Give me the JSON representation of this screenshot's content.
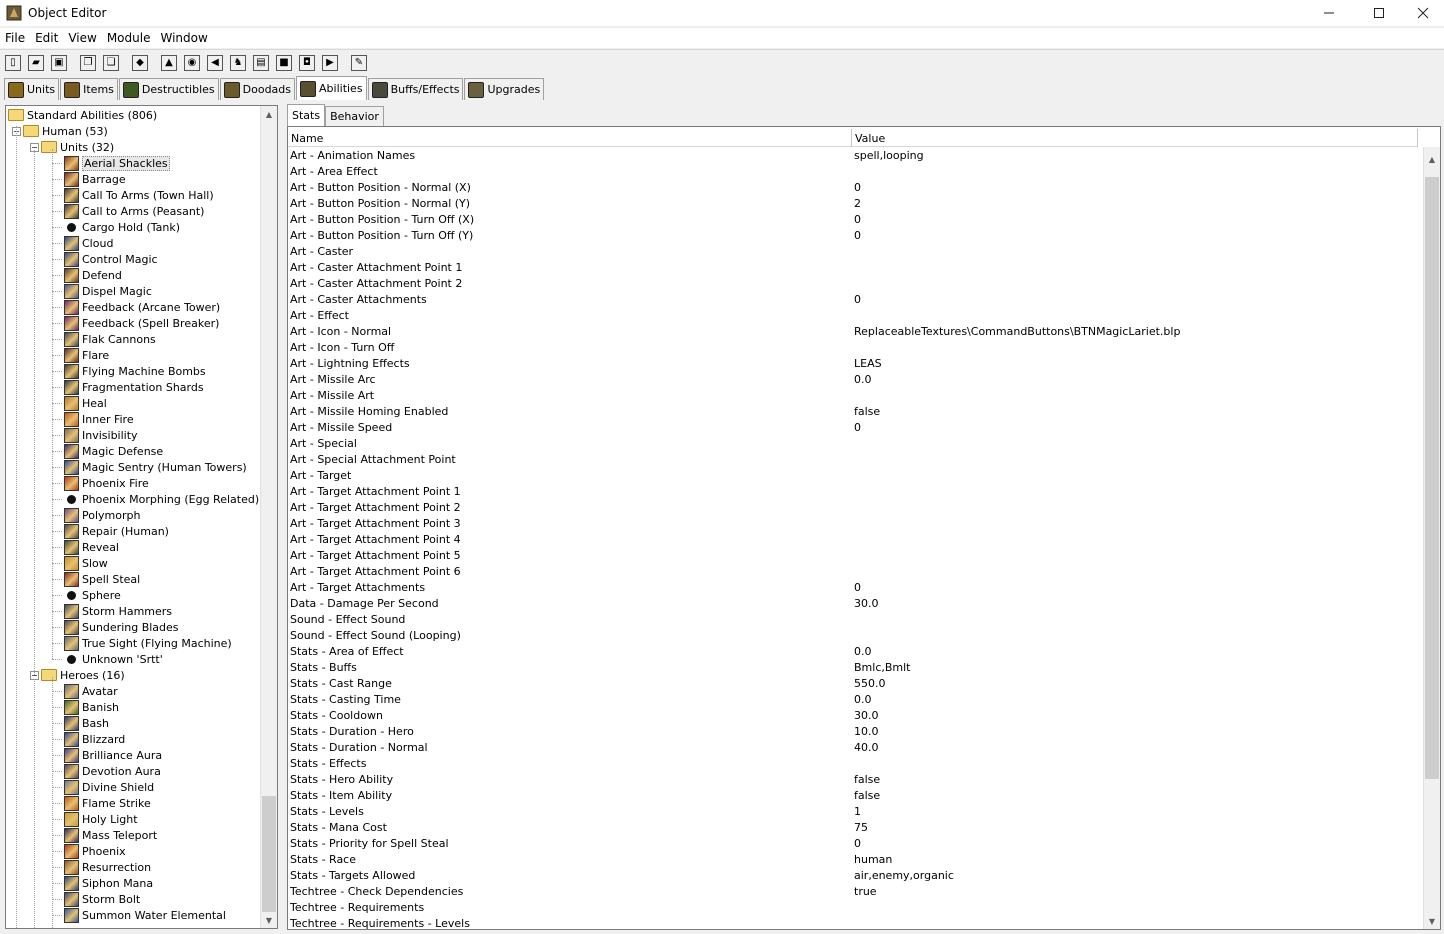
{
  "window": {
    "title": "Object Editor"
  },
  "menu": [
    "File",
    "Edit",
    "View",
    "Module",
    "Window"
  ],
  "toolbar": [
    {
      "icon": "new-icon",
      "glyph": "▯"
    },
    {
      "icon": "open-icon",
      "glyph": "▰"
    },
    {
      "icon": "save-icon",
      "glyph": "▣"
    },
    {
      "sep": true
    },
    {
      "icon": "copy-icon",
      "glyph": "❐"
    },
    {
      "icon": "paste-icon",
      "glyph": "❏"
    },
    {
      "sep": true
    },
    {
      "icon": "terrain-editor-icon",
      "glyph": "◆"
    },
    {
      "sep": true
    },
    {
      "icon": "trigger-editor-icon",
      "glyph": "▲"
    },
    {
      "icon": "sound-editor-icon",
      "glyph": "◉"
    },
    {
      "icon": "speaker-icon",
      "glyph": "◀"
    },
    {
      "icon": "object-editor-icon",
      "glyph": "♞"
    },
    {
      "icon": "campaign-editor-icon",
      "glyph": "▤"
    },
    {
      "icon": "ai-editor-icon",
      "glyph": "■"
    },
    {
      "icon": "import-manager-icon",
      "glyph": "◘"
    },
    {
      "icon": "test-map-icon",
      "glyph": "▶"
    },
    {
      "sep": true
    },
    {
      "icon": "object-manager-icon",
      "glyph": "✎"
    }
  ],
  "object_tabs": [
    {
      "label": "Units",
      "icon": "units-icon",
      "color": "#8a6a1a",
      "active": false
    },
    {
      "label": "Items",
      "icon": "items-icon",
      "color": "#7a5a20",
      "active": false
    },
    {
      "label": "Destructibles",
      "icon": "destructibles-icon",
      "color": "#3c5a22",
      "active": false
    },
    {
      "label": "Doodads",
      "icon": "doodads-icon",
      "color": "#6b5a2a",
      "active": false
    },
    {
      "label": "Abilities",
      "icon": "abilities-icon",
      "color": "#5a5030",
      "active": true
    },
    {
      "label": "Buffs/Effects",
      "icon": "buffs-icon",
      "color": "#4a4a3a",
      "active": false
    },
    {
      "label": "Upgrades",
      "icon": "upgrades-icon",
      "color": "#6a6040",
      "active": false
    }
  ],
  "tree": {
    "root": "Standard Abilities (806)",
    "human": "Human (53)",
    "units_folder": "Units (32)",
    "heroes_folder": "Heroes (16)",
    "units": [
      {
        "label": "Aerial Shackles",
        "color": "#8a3a1a",
        "selected": true
      },
      {
        "label": "Barrage",
        "color": "#7a2a2a"
      },
      {
        "label": "Call To Arms (Town Hall)",
        "color": "#3a3a3a"
      },
      {
        "label": "Call to Arms (Peasant)",
        "color": "#3a3a3a"
      },
      {
        "label": "Cargo Hold (Tank)",
        "color": "#202020",
        "tiny": true
      },
      {
        "label": "Cloud",
        "color": "#2a4a8a"
      },
      {
        "label": "Control Magic",
        "color": "#3a4a7a"
      },
      {
        "label": "Defend",
        "color": "#5a3a2a"
      },
      {
        "label": "Dispel Magic",
        "color": "#4a5a8a"
      },
      {
        "label": "Feedback (Arcane Tower)",
        "color": "#6a2a6a"
      },
      {
        "label": "Feedback (Spell Breaker)",
        "color": "#6a2a6a"
      },
      {
        "label": "Flak Cannons",
        "color": "#3a4a5a"
      },
      {
        "label": "Flare",
        "color": "#5a2a2a"
      },
      {
        "label": "Flying Machine Bombs",
        "color": "#3a3a3a"
      },
      {
        "label": "Fragmentation Shards",
        "color": "#2a3a4a"
      },
      {
        "label": "Heal",
        "color": "#b07a2a"
      },
      {
        "label": "Inner Fire",
        "color": "#c05a1a"
      },
      {
        "label": "Invisibility",
        "color": "#7a6a5a"
      },
      {
        "label": "Magic Defense",
        "color": "#3a2a6a"
      },
      {
        "label": "Magic Sentry (Human Towers)",
        "color": "#2a4a9a"
      },
      {
        "label": "Phoenix Fire",
        "color": "#b03a1a"
      },
      {
        "label": "Phoenix Morphing (Egg Related)",
        "color": "#202020",
        "tiny": true
      },
      {
        "label": "Polymorph",
        "color": "#6a4a8a"
      },
      {
        "label": "Repair (Human)",
        "color": "#4a4a4a"
      },
      {
        "label": "Reveal",
        "color": "#3a4a3a"
      },
      {
        "label": "Slow",
        "color": "#c0902a"
      },
      {
        "label": "Spell Steal",
        "color": "#8a2a2a"
      },
      {
        "label": "Sphere",
        "color": "#202020",
        "tiny": true
      },
      {
        "label": "Storm Hammers",
        "color": "#3a4a6a"
      },
      {
        "label": "Sundering Blades",
        "color": "#4a4a5a"
      },
      {
        "label": "True Sight (Flying Machine)",
        "color": "#5a6a7a"
      },
      {
        "label": "Unknown 'Srtt'",
        "color": "#202020",
        "tiny": true
      }
    ],
    "heroes": [
      {
        "label": "Avatar",
        "color": "#5a6a8a"
      },
      {
        "label": "Banish",
        "color": "#3a6a2a"
      },
      {
        "label": "Bash",
        "color": "#2a3a6a"
      },
      {
        "label": "Blizzard",
        "color": "#2a4a9a"
      },
      {
        "label": "Brilliance Aura",
        "color": "#3a3a8a"
      },
      {
        "label": "Devotion Aura",
        "color": "#4a4a5a"
      },
      {
        "label": "Divine Shield",
        "color": "#6a7a9a"
      },
      {
        "label": "Flame Strike",
        "color": "#c05a1a"
      },
      {
        "label": "Holy Light",
        "color": "#c0a030"
      },
      {
        "label": "Mass Teleport",
        "color": "#2a2a5a"
      },
      {
        "label": "Phoenix",
        "color": "#b03a1a"
      },
      {
        "label": "Resurrection",
        "color": "#8a5a2a"
      },
      {
        "label": "Siphon Mana",
        "color": "#2a4a7a"
      },
      {
        "label": "Storm Bolt",
        "color": "#3a4a6a"
      },
      {
        "label": "Summon Water Elemental",
        "color": "#2a5a9a"
      }
    ]
  },
  "subtabs": [
    {
      "label": "Stats",
      "active": true
    },
    {
      "label": "Behavior",
      "active": false
    }
  ],
  "grid": {
    "col_name": "Name",
    "col_value": "Value",
    "rows": [
      {
        "n": "Art - Animation Names",
        "v": "spell,looping"
      },
      {
        "n": "Art - Area Effect",
        "v": ""
      },
      {
        "n": "Art - Button Position - Normal (X)",
        "v": "0"
      },
      {
        "n": "Art - Button Position - Normal (Y)",
        "v": "2"
      },
      {
        "n": "Art - Button Position - Turn Off (X)",
        "v": "0"
      },
      {
        "n": "Art - Button Position - Turn Off (Y)",
        "v": "0"
      },
      {
        "n": "Art - Caster",
        "v": ""
      },
      {
        "n": "Art - Caster Attachment Point 1",
        "v": ""
      },
      {
        "n": "Art - Caster Attachment Point 2",
        "v": ""
      },
      {
        "n": "Art - Caster Attachments",
        "v": "0"
      },
      {
        "n": "Art - Effect",
        "v": ""
      },
      {
        "n": "Art - Icon - Normal",
        "v": "ReplaceableTextures\\CommandButtons\\BTNMagicLariet.blp"
      },
      {
        "n": "Art - Icon - Turn Off",
        "v": ""
      },
      {
        "n": "Art - Lightning Effects",
        "v": "LEAS"
      },
      {
        "n": "Art - Missile Arc",
        "v": "0.0"
      },
      {
        "n": "Art - Missile Art",
        "v": ""
      },
      {
        "n": "Art - Missile Homing Enabled",
        "v": "false"
      },
      {
        "n": "Art - Missile Speed",
        "v": "0"
      },
      {
        "n": "Art - Special",
        "v": ""
      },
      {
        "n": "Art - Special Attachment Point",
        "v": ""
      },
      {
        "n": "Art - Target",
        "v": ""
      },
      {
        "n": "Art - Target Attachment Point 1",
        "v": ""
      },
      {
        "n": "Art - Target Attachment Point 2",
        "v": ""
      },
      {
        "n": "Art - Target Attachment Point 3",
        "v": ""
      },
      {
        "n": "Art - Target Attachment Point 4",
        "v": ""
      },
      {
        "n": "Art - Target Attachment Point 5",
        "v": ""
      },
      {
        "n": "Art - Target Attachment Point 6",
        "v": ""
      },
      {
        "n": "Art - Target Attachments",
        "v": "0"
      },
      {
        "n": "Data - Damage Per Second",
        "v": "30.0"
      },
      {
        "n": "Sound - Effect Sound",
        "v": ""
      },
      {
        "n": "Sound - Effect Sound (Looping)",
        "v": ""
      },
      {
        "n": "Stats - Area of Effect",
        "v": "0.0"
      },
      {
        "n": "Stats - Buffs",
        "v": "Bmlc,Bmlt"
      },
      {
        "n": "Stats - Cast Range",
        "v": "550.0"
      },
      {
        "n": "Stats - Casting Time",
        "v": "0.0"
      },
      {
        "n": "Stats - Cooldown",
        "v": "30.0"
      },
      {
        "n": "Stats - Duration - Hero",
        "v": "10.0"
      },
      {
        "n": "Stats - Duration - Normal",
        "v": "40.0"
      },
      {
        "n": "Stats - Effects",
        "v": ""
      },
      {
        "n": "Stats - Hero Ability",
        "v": "false"
      },
      {
        "n": "Stats - Item Ability",
        "v": "false"
      },
      {
        "n": "Stats - Levels",
        "v": "1"
      },
      {
        "n": "Stats - Mana Cost",
        "v": "75"
      },
      {
        "n": "Stats - Priority for Spell Steal",
        "v": "0"
      },
      {
        "n": "Stats - Race",
        "v": "human"
      },
      {
        "n": "Stats - Targets Allowed",
        "v": "air,enemy,organic"
      },
      {
        "n": "Techtree - Check Dependencies",
        "v": "true"
      },
      {
        "n": "Techtree - Requirements",
        "v": ""
      },
      {
        "n": "Techtree - Requirements - Levels",
        "v": ""
      }
    ]
  }
}
